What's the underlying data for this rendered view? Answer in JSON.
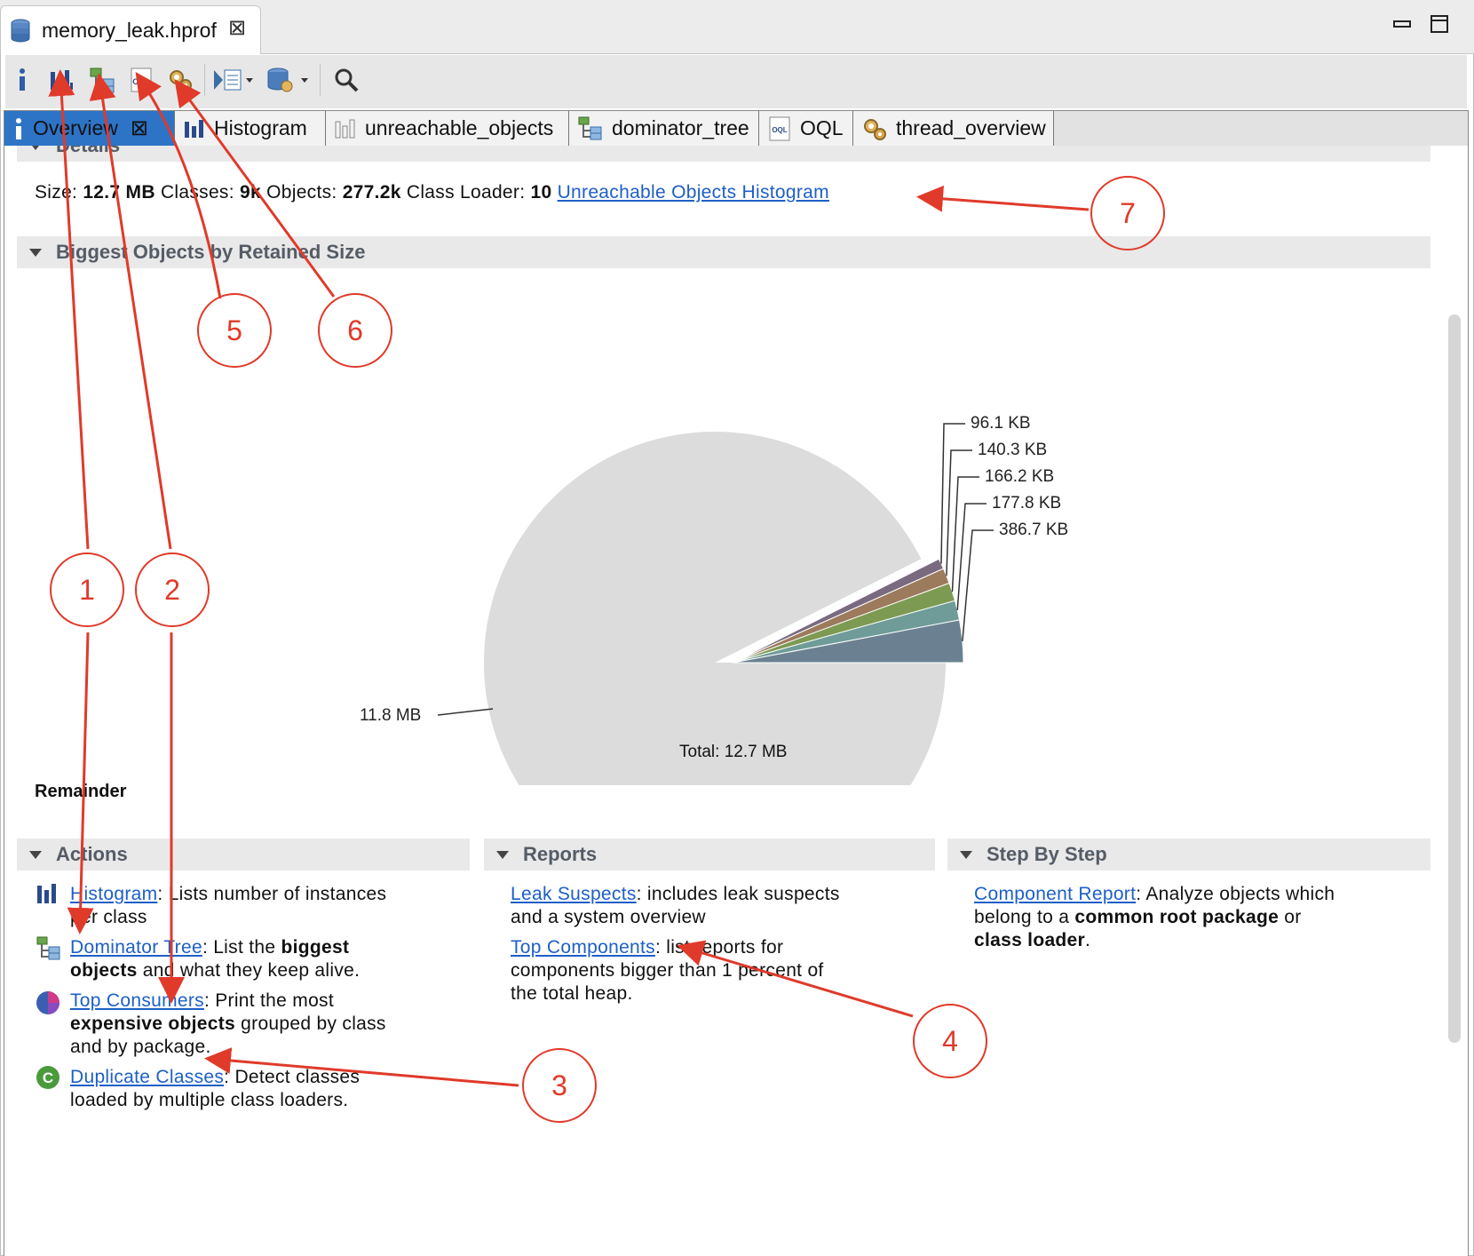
{
  "window": {
    "file_tab_label": "memory_leak.hprof",
    "close_glyph": "⊠"
  },
  "toolbar": {
    "items": [
      "info-icon",
      "histogram-icon",
      "dominator-tree-icon",
      "oql-icon",
      "thread-overview-icon",
      "run-report-icon",
      "heap-dump-icon",
      "search-icon"
    ]
  },
  "subtabs": [
    {
      "label": "Overview",
      "icon": "info-icon",
      "active": true
    },
    {
      "label": "Histogram",
      "icon": "histogram-icon"
    },
    {
      "label": "unreachable_objects",
      "icon": "histogram-outline-icon"
    },
    {
      "label": "dominator_tree",
      "icon": "dominator-tree-icon"
    },
    {
      "label": "OQL",
      "icon": "oql-icon"
    },
    {
      "label": "thread_overview",
      "icon": "thread-overview-icon"
    }
  ],
  "details": {
    "header": "Details",
    "size_label": "Size:",
    "size_value": "12.7 MB",
    "classes_label": "Classes:",
    "classes_value": "9k",
    "objects_label": "Objects:",
    "objects_value": "277.2k",
    "classloader_label": "Class Loader:",
    "classloader_value": "10",
    "histogram_link": "Unreachable Objects Histogram"
  },
  "biggest": {
    "header": "Biggest Objects by Retained Size",
    "total_label": "Total: 12.7 MB",
    "remainder_label": "Remainder"
  },
  "chart_data": {
    "type": "pie",
    "title": "",
    "slices": [
      {
        "label": "11.8 MB",
        "value": 11.8,
        "unit": "MB",
        "color": "#dcdcdc"
      },
      {
        "label": "386.7 KB",
        "value": 386.7,
        "unit": "KB",
        "color": "#6b8191"
      },
      {
        "label": "177.8 KB",
        "value": 177.8,
        "unit": "KB",
        "color": "#6f9c98"
      },
      {
        "label": "166.2 KB",
        "value": 166.2,
        "unit": "KB",
        "color": "#7d9a52"
      },
      {
        "label": "140.3 KB",
        "value": 140.3,
        "unit": "KB",
        "color": "#9c7a5c"
      },
      {
        "label": "96.1 KB",
        "value": 96.1,
        "unit": "KB",
        "color": "#7a6a80"
      }
    ]
  },
  "actions": {
    "header": "Actions",
    "items": [
      {
        "link": "Histogram",
        "text": ": Lists number of instances",
        "text2": "per class"
      },
      {
        "link": "Dominator Tree",
        "text": ": List the",
        "bold": "biggest",
        "bold2": "objects",
        "text2": "and what they keep alive."
      },
      {
        "link": "Top Consumers",
        "text": ": Print the most",
        "bold2": "expensive objects",
        "text2": "grouped by class",
        "text3": "and by package."
      },
      {
        "link": "Duplicate Classes",
        "text": ": Detect classes",
        "text2": "loaded by multiple class loaders."
      }
    ]
  },
  "reports": {
    "header": "Reports",
    "items": [
      {
        "link": "Leak Suspects",
        "text": ": includes leak suspects",
        "text2": "and a system overview"
      },
      {
        "link": "Top Components",
        "text": ": list reports for",
        "text2": "components bigger than 1 percent of",
        "text3": "the total heap."
      }
    ]
  },
  "stepbystep": {
    "header": "Step By Step",
    "items": [
      {
        "link": "Component Report",
        "text": ": Analyze objects which",
        "text2a": "belong to a",
        "bold": "common root package",
        "text2b": "or",
        "bold2": "class loader",
        "text3": "."
      }
    ]
  },
  "annotations": [
    "1",
    "2",
    "3",
    "4",
    "5",
    "6",
    "7"
  ],
  "colors": {
    "accent_blue": "#2d74c7",
    "link_blue": "#1d5fc7",
    "annotation_red": "#e03a2a"
  }
}
